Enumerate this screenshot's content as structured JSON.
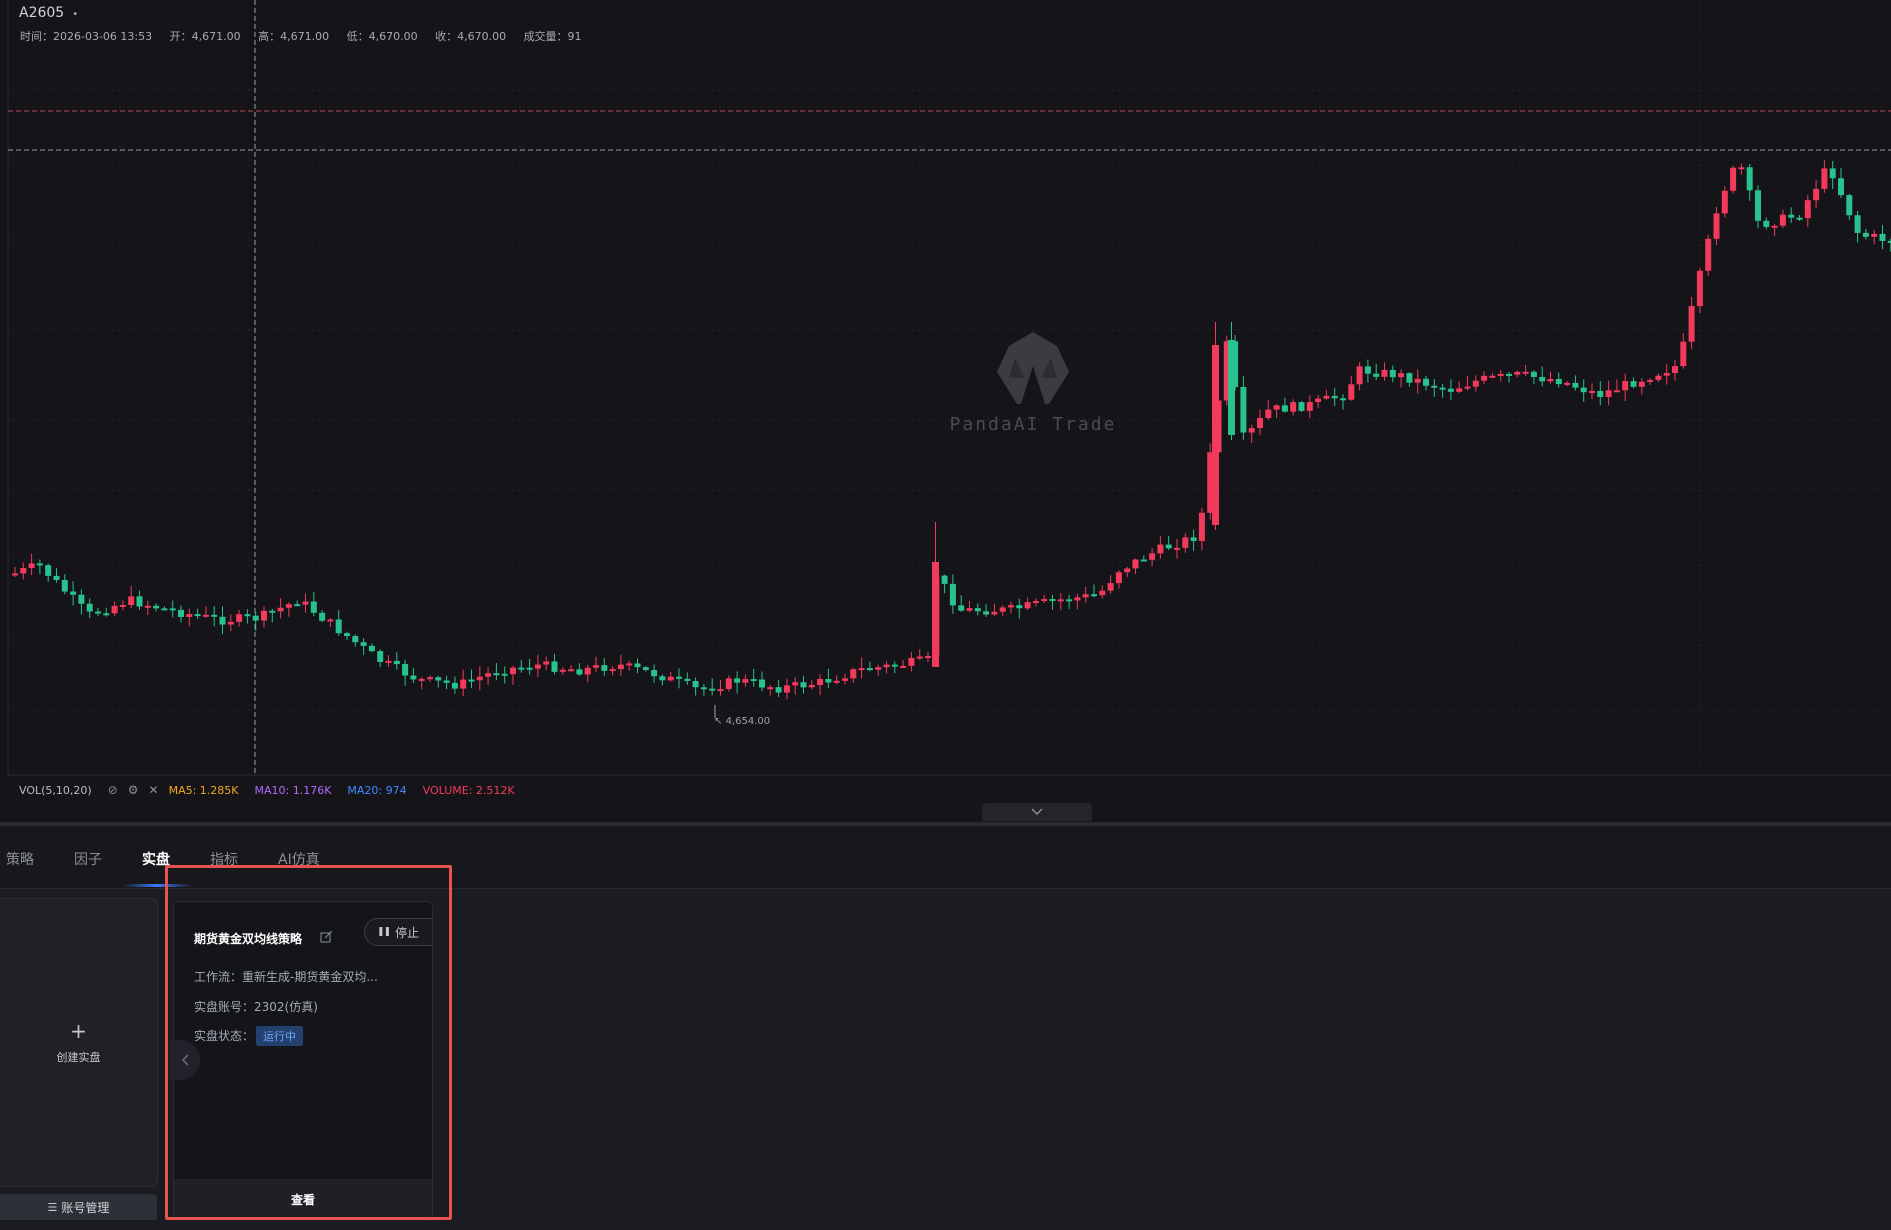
{
  "chart": {
    "symbol": "A2605",
    "ohlc": {
      "time": "时间：2026-03-06 13:53",
      "open": "开：4,671.00",
      "high": "高：4,671.00",
      "low": "低：4,670.00",
      "close": "收：4,670.00",
      "volume": "成交量：91"
    },
    "watermark": "PandaAI Trade",
    "low_marker": "4,654.00",
    "colors": {
      "up": "#f23a5c",
      "down": "#29c28e",
      "background": "#151519",
      "grid": "#24252c"
    }
  },
  "chart_data": {
    "type": "candlestick",
    "title": "A2605",
    "candle_count": 190,
    "annotations": [
      "4,654.00"
    ],
    "volume_indicator": "VOL(5,10,20)",
    "grid": true
  },
  "volume_bar": {
    "label": "VOL(5,10,20)",
    "ma5": "MA5: 1.285K",
    "ma10": "MA10: 1.176K",
    "ma20": "MA20: 974",
    "volume": "VOLUME: 2.512K",
    "ma5_color": "#f5a623",
    "ma10_color": "#b26bff",
    "ma20_color": "#3d8bff",
    "volume_color": "#f23a5c"
  },
  "tabs": [
    {
      "label": "策略"
    },
    {
      "label": "因子"
    },
    {
      "label": "实盘",
      "active": true
    },
    {
      "label": "指标"
    },
    {
      "label": "AI仿真"
    }
  ],
  "create_card": {
    "label": "创建实盘"
  },
  "account_button": {
    "label": "账号管理"
  },
  "strategy_card": {
    "title": "期货黄金双均线策略",
    "stop_label": "停止",
    "workflow_label": "工作流：",
    "workflow_value": "重新生成-期货黄金双均...",
    "account_label": "实盘账号：",
    "account_value": "2302(仿真)",
    "status_label": "实盘状态：",
    "status_value": "运行中",
    "view_label": "查看"
  }
}
